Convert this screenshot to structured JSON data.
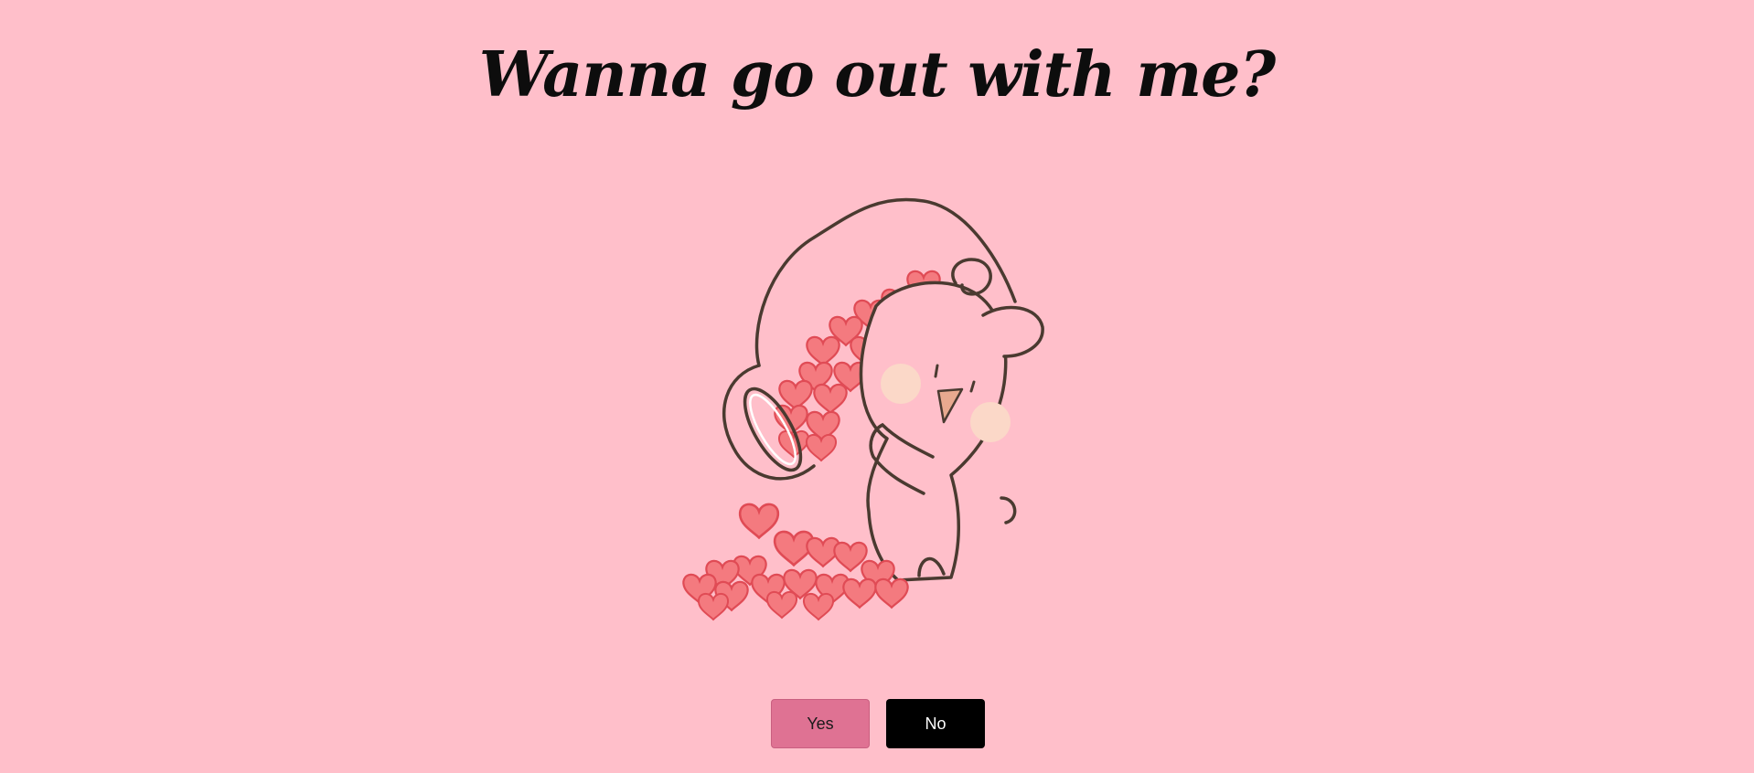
{
  "title": "Wanna go out with me?",
  "buttons": {
    "yes_label": "Yes",
    "no_label": "No"
  },
  "illustration": {
    "name": "bunny-pouring-hearts-from-jar"
  },
  "colors": {
    "background": "#ffbfca",
    "yes_button": "#df7293",
    "no_button": "#000000",
    "heart_fill": "#f47a7f",
    "heart_stroke": "#e04b55",
    "outline": "#4a3a30",
    "blush": "#fbd8c8"
  }
}
